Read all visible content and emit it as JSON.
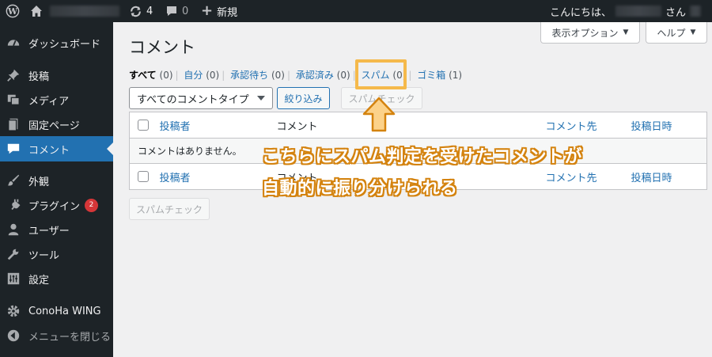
{
  "adminbar": {
    "updates_count": "4",
    "comments_count": "0",
    "new_label": "新規",
    "greeting": "こんにちは、",
    "greeting_suffix": "さん"
  },
  "sidebar": {
    "items": [
      {
        "label": "ダッシュボード",
        "icon": "dashboard-icon"
      },
      {
        "label": "投稿",
        "icon": "pin-icon"
      },
      {
        "label": "メディア",
        "icon": "media-icon"
      },
      {
        "label": "固定ページ",
        "icon": "page-icon"
      },
      {
        "label": "コメント",
        "icon": "comment-icon"
      },
      {
        "label": "外観",
        "icon": "brush-icon"
      },
      {
        "label": "プラグイン",
        "icon": "plugin-icon",
        "badge": "2"
      },
      {
        "label": "ユーザー",
        "icon": "user-icon"
      },
      {
        "label": "ツール",
        "icon": "wrench-icon"
      },
      {
        "label": "設定",
        "icon": "settings-icon"
      },
      {
        "label": "ConoHa WING",
        "icon": "gear-icon"
      },
      {
        "label": "メニューを閉じる",
        "icon": "collapse-icon"
      }
    ]
  },
  "screen_options": {
    "label": "表示オプション",
    "help_label": "ヘルプ"
  },
  "page": {
    "title": "コメント"
  },
  "filters": [
    {
      "label": "すべて",
      "count": "(0)"
    },
    {
      "label": "自分",
      "count": "(0)"
    },
    {
      "label": "承認待ち",
      "count": "(0)"
    },
    {
      "label": "承認済み",
      "count": "(0)"
    },
    {
      "label": "スパム",
      "count": "(0)"
    },
    {
      "label": "ゴミ箱",
      "count": "(1)"
    }
  ],
  "toolbar": {
    "type_select": "すべてのコメントタイプ",
    "filter_button": "絞り込み",
    "spam_check_button": "スパムチェック"
  },
  "table": {
    "columns": [
      "投稿者",
      "コメント",
      "コメント先",
      "投稿日時"
    ],
    "empty_message": "コメントはありません。"
  },
  "annotation": {
    "line1": "こちらにスパム判定を受けたコメントが",
    "line2": "自動的に振り分けられる",
    "highlight_color": "#f5b94b"
  }
}
